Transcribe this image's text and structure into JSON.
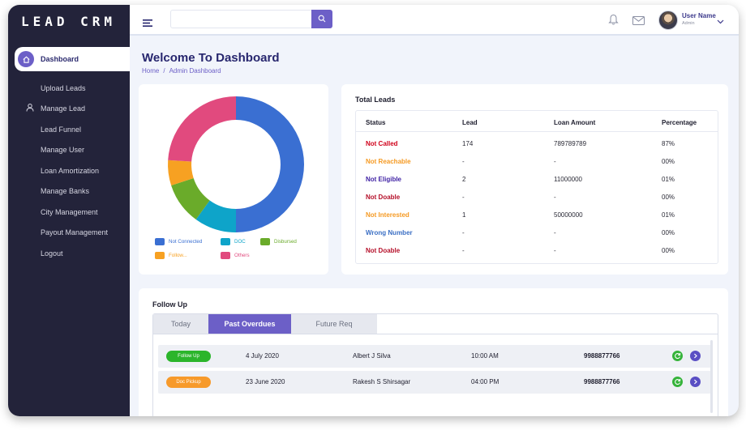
{
  "app": {
    "logo": "LEAD CRM"
  },
  "sidebar": {
    "items": [
      {
        "label": "Dashboard",
        "icon": "home-icon",
        "active": true
      },
      {
        "label": "Upload Leads"
      },
      {
        "label": "Manage Lead",
        "icon": "user-icon"
      },
      {
        "label": "Lead Funnel"
      },
      {
        "label": "Manage User"
      },
      {
        "label": "Loan Amortization"
      },
      {
        "label": "Manage Banks"
      },
      {
        "label": "City Management"
      },
      {
        "label": "Payout Management"
      },
      {
        "label": "Logout"
      }
    ]
  },
  "topbar": {
    "search_value": "",
    "user_name": "User Name",
    "user_role": "Admin"
  },
  "page": {
    "title": "Welcome To Dashboard",
    "breadcrumb": [
      "Home",
      "Admin Dashboard"
    ]
  },
  "chart_data": {
    "type": "pie",
    "categories": [
      "Not Connected",
      "DOC",
      "Disbursed",
      "Follow...",
      "Others"
    ],
    "values": [
      50,
      10,
      10,
      6,
      24
    ],
    "colors": [
      "#3a6fd2",
      "#0ea4c9",
      "#6aab2a",
      "#f7a122",
      "#e14a7e"
    ],
    "legend": "bottom"
  },
  "total_leads": {
    "title": "Total Leads",
    "columns": [
      "Status",
      "Lead",
      "Loan Amount",
      "Percentage"
    ],
    "rows": [
      {
        "status": "Not Called",
        "color": "#d0021b",
        "lead": "174",
        "amount": "789789789",
        "pct": "87%"
      },
      {
        "status": "Not Reachable",
        "color": "#f59a23",
        "lead": "-",
        "amount": "-",
        "pct": "00%"
      },
      {
        "status": "Not Eligible",
        "color": "#3d1fa3",
        "lead": "2",
        "amount": "11000000",
        "pct": "01%"
      },
      {
        "status": "Not Doable",
        "color": "#b5102a",
        "lead": "-",
        "amount": "-",
        "pct": "00%"
      },
      {
        "status": "Not Interested",
        "color": "#f59a23",
        "lead": "1",
        "amount": "50000000",
        "pct": "01%"
      },
      {
        "status": "Wrong Number",
        "color": "#3b6fc4",
        "lead": "-",
        "amount": "-",
        "pct": "00%"
      },
      {
        "status": "Not Doable",
        "color": "#b5102a",
        "lead": "-",
        "amount": "-",
        "pct": "00%"
      }
    ]
  },
  "follow_up": {
    "title": "Follow Up",
    "tabs": [
      {
        "label": "Today",
        "active": false
      },
      {
        "label": "Past Overdues",
        "active": true
      },
      {
        "label": "Future Req",
        "active": false
      }
    ],
    "rows": [
      {
        "tag": "Follow Up",
        "tag_color": "#2bb52b",
        "date": "4 July 2020",
        "name": "Albert J Silva",
        "time": "10:00 AM",
        "phone": "9988877766"
      },
      {
        "tag": "Doc Pickup",
        "tag_color": "#f79a2b",
        "date": "23 June 2020",
        "name": "Rakesh S Shirsagar",
        "time": "04:00 PM",
        "phone": "9988877766"
      }
    ]
  }
}
